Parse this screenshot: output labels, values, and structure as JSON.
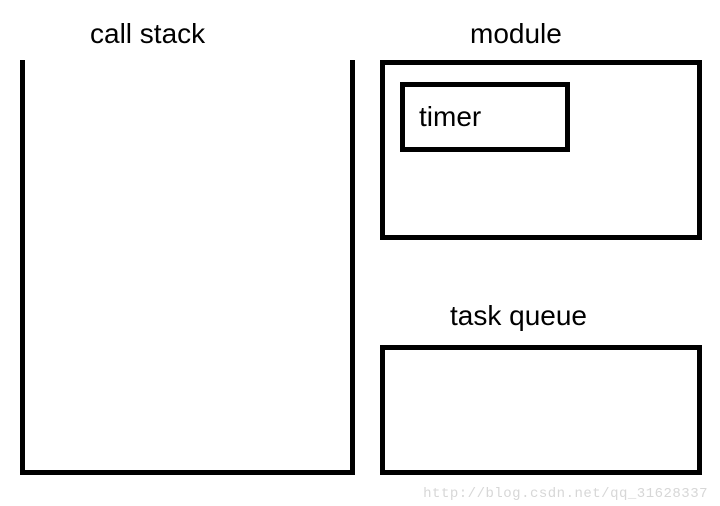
{
  "labels": {
    "call_stack": "call stack",
    "module": "module",
    "timer": "timer",
    "task_queue": "task queue"
  },
  "watermark": "http://blog.csdn.net/qq_31628337"
}
